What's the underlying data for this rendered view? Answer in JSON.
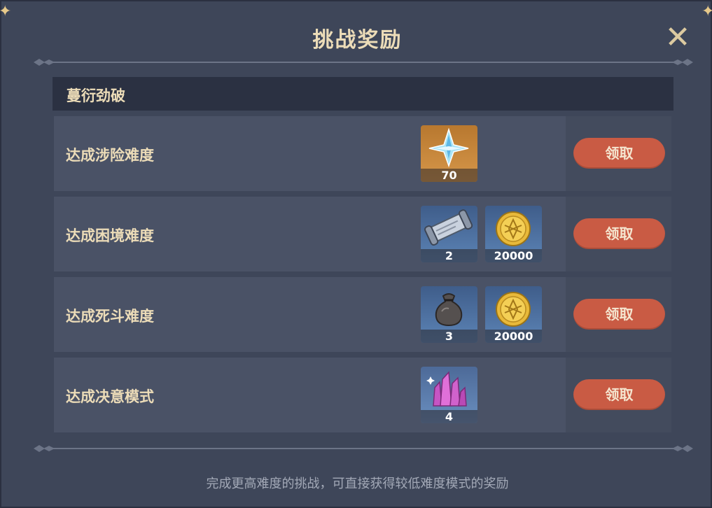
{
  "dialog": {
    "title": "挑战奖励",
    "close_icon": "close-icon"
  },
  "section": {
    "title": "蔓衍劲破"
  },
  "rows": [
    {
      "label": "达成涉险难度",
      "rewards": [
        {
          "icon": "primogem-icon",
          "count": "70"
        }
      ],
      "button": "领取"
    },
    {
      "label": "达成困境难度",
      "rewards": [
        {
          "icon": "scroll-icon",
          "count": "2"
        },
        {
          "icon": "mora-coin-icon",
          "count": "20000"
        }
      ],
      "button": "领取"
    },
    {
      "label": "达成死斗难度",
      "rewards": [
        {
          "icon": "pouch-icon",
          "count": "3"
        },
        {
          "icon": "mora-coin-icon",
          "count": "20000"
        }
      ],
      "button": "领取"
    },
    {
      "label": "达成决意模式",
      "rewards": [
        {
          "icon": "crystal-icon",
          "count": "4"
        }
      ],
      "button": "领取"
    }
  ],
  "footer": {
    "note": "完成更高难度的挑战，可直接获得较低难度模式的奖励"
  },
  "colors": {
    "panel_bg": "#3e4659",
    "row_bg": "#4a5266",
    "claim_button": "#c95b44",
    "title_text": "#ecdcb8"
  }
}
